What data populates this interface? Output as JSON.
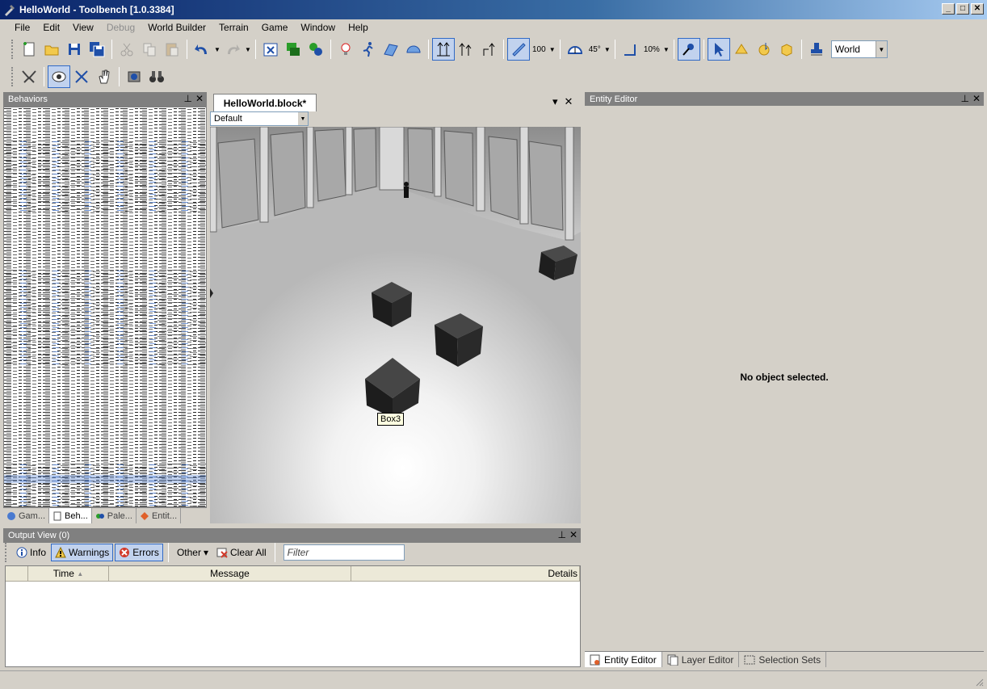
{
  "window": {
    "title": "HelloWorld - Toolbench [1.0.3384]"
  },
  "menu": [
    "File",
    "Edit",
    "View",
    "Debug",
    "World Builder",
    "Terrain",
    "Game",
    "Window",
    "Help"
  ],
  "toolbar": {
    "snap_value": "100",
    "angle_value": "45°",
    "percent_value": "10%",
    "space_combo": "World"
  },
  "behaviors": {
    "title": "Behaviors",
    "tabs": [
      "Gam...",
      "Beh...",
      "Pale...",
      "Entit..."
    ]
  },
  "document": {
    "tab": "HelloWorld.block*",
    "view_combo": "Default",
    "tooltip": "Box3"
  },
  "output": {
    "title": "Output View (0)",
    "buttons": {
      "info": "Info",
      "warnings": "Warnings",
      "errors": "Errors",
      "other": "Other",
      "clear": "Clear All"
    },
    "filter_placeholder": "Filter",
    "columns": [
      "Time",
      "Message",
      "Details"
    ]
  },
  "entity_editor": {
    "title": "Entity Editor",
    "empty_message": "No object selected.",
    "tabs": [
      "Entity Editor",
      "Layer Editor",
      "Selection Sets"
    ]
  }
}
